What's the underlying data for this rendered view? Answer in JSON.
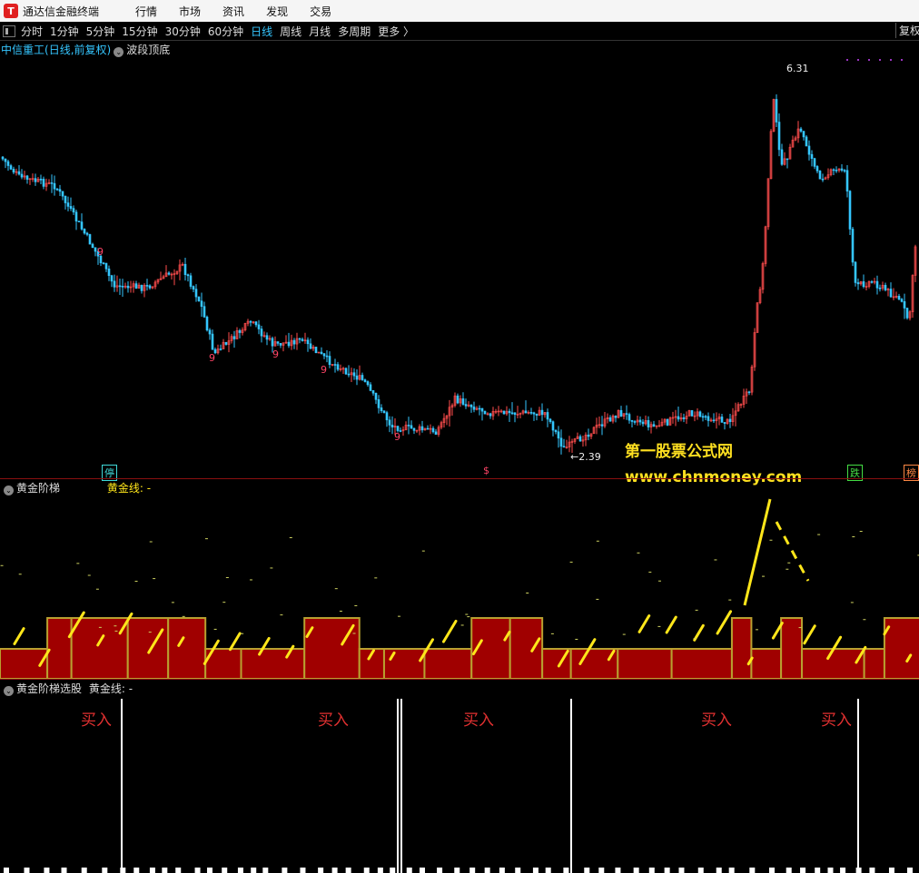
{
  "window": {
    "title": "通达信金融终端",
    "menu": [
      "行情",
      "市场",
      "资讯",
      "发现",
      "交易"
    ]
  },
  "toolbar": {
    "periods": [
      "分时",
      "1分钟",
      "5分钟",
      "15分钟",
      "30分钟",
      "60分钟",
      "日线",
      "周线",
      "月线",
      "多周期",
      "更多 〉"
    ],
    "active_period": "日线",
    "right_button": "复权"
  },
  "main_chart": {
    "stock_name": "中信重工",
    "info": "(日线,前复权)",
    "indicator": "波段顶底",
    "high_label": "6.31",
    "low_label": "2.39",
    "tags": [
      "停",
      "$",
      "跌",
      "榜"
    ],
    "count_marks": [
      "9",
      "9",
      "9",
      "9",
      "9"
    ]
  },
  "watermark": {
    "line1": "第一股票公式网",
    "line2": "www.chnmoney.com"
  },
  "panel2": {
    "name": "黄金阶梯",
    "series_label": "黄金线:",
    "series_value": "-"
  },
  "panel3": {
    "name": "黄金阶梯选股",
    "series_label": "黄金线:",
    "series_value": "-",
    "signal_label": "买入"
  },
  "colors": {
    "up": "#ff4d4d",
    "down": "#35c6ff",
    "gold": "#ffe61a",
    "band": "#a00000",
    "band_edge": "#b8a030"
  }
}
